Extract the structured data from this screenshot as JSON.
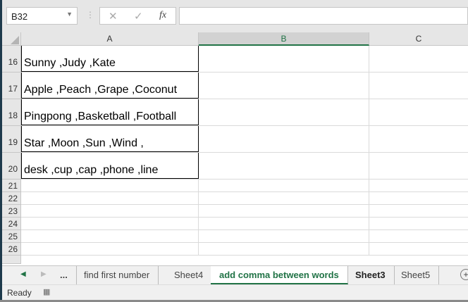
{
  "name_box": "B32",
  "formula_buttons": {
    "cancel": "✕",
    "enter": "✓",
    "fx": "fx"
  },
  "formula_value": "",
  "columns": [
    "A",
    "B",
    "C"
  ],
  "selected_column": "B",
  "rows": [
    {
      "num": "16",
      "a": "Sunny ,Judy ,Kate"
    },
    {
      "num": "17",
      "a": "Apple ,Peach ,Grape ,Coconut"
    },
    {
      "num": "18",
      "a": "Pingpong ,Basketball ,Football"
    },
    {
      "num": "19",
      "a": "Star ,Moon ,Sun ,Wind ,"
    },
    {
      "num": "20",
      "a": "desk ,cup ,cap ,phone ,line"
    },
    {
      "num": "21",
      "a": ""
    },
    {
      "num": "22",
      "a": ""
    },
    {
      "num": "23",
      "a": ""
    },
    {
      "num": "24",
      "a": ""
    },
    {
      "num": "25",
      "a": ""
    },
    {
      "num": "26",
      "a": ""
    }
  ],
  "tabs": {
    "nav_more": "...",
    "items": [
      "find first number",
      "Sheet4",
      "add comma between words",
      "Sheet3",
      "Sheet5"
    ],
    "active": "add comma between words"
  },
  "status": "Ready"
}
